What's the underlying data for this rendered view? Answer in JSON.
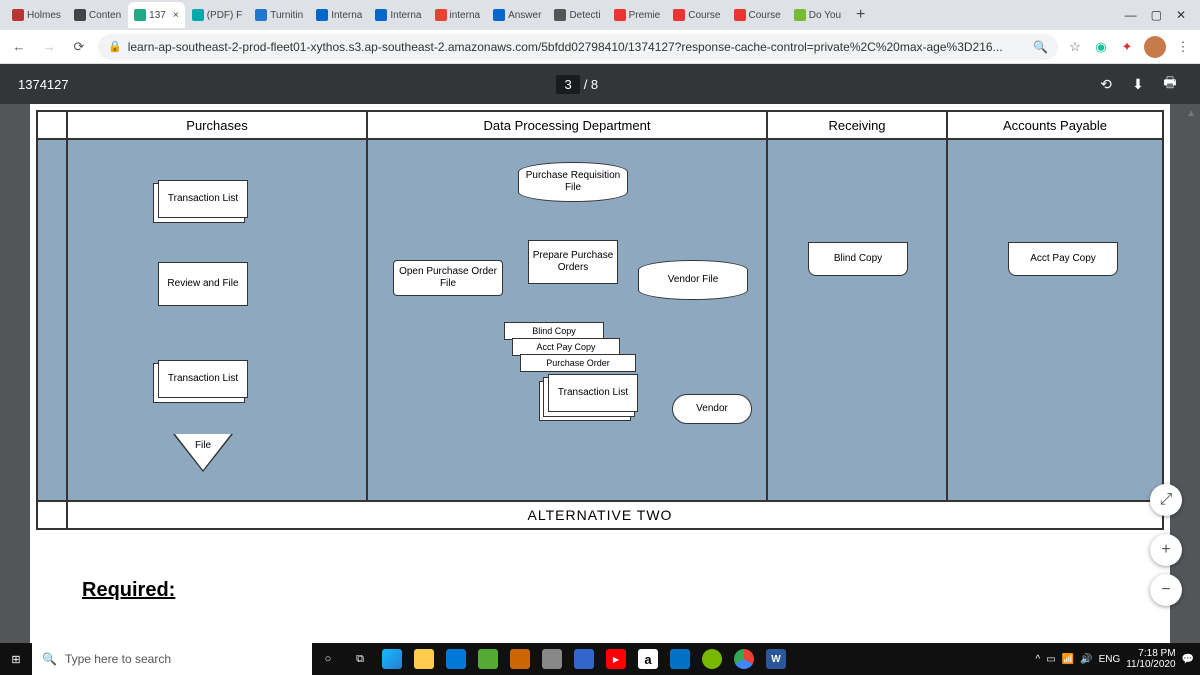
{
  "tabs": [
    {
      "label": "Holmes",
      "fav": "#b33"
    },
    {
      "label": "Conten",
      "fav": "#444"
    },
    {
      "label": "137",
      "fav": "#2a8",
      "active": true,
      "closable": true
    },
    {
      "label": "(PDF) F",
      "fav": "#0aa"
    },
    {
      "label": "Turnitin",
      "fav": "#27c"
    },
    {
      "label": "Interna",
      "fav": "#06c"
    },
    {
      "label": "Interna",
      "fav": "#06c"
    },
    {
      "label": "interna",
      "fav": "#ea4335"
    },
    {
      "label": "Answer",
      "fav": "#06c"
    },
    {
      "label": "Detecti",
      "fav": "#555"
    },
    {
      "label": "Premie",
      "fav": "#e33"
    },
    {
      "label": "Course",
      "fav": "#e33"
    },
    {
      "label": "Course",
      "fav": "#e33"
    },
    {
      "label": "Do You",
      "fav": "#7b3"
    }
  ],
  "url": "learn-ap-southeast-2-prod-fleet01-xythos.s3.ap-southeast-2.amazonaws.com/5bfdd02798410/1374127?response-cache-control=private%2C%20max-age%3D216...",
  "pdf": {
    "filename": "1374127",
    "curPage": "3",
    "totalPages": "/ 8"
  },
  "diagram": {
    "cols": {
      "c1": "Purchases",
      "c2": "Data Processing Department",
      "c3": "Receiving",
      "c4": "Accounts Payable"
    },
    "nodes": {
      "transList1": "Transaction\nList",
      "review": "Review\nand\nFile",
      "transList2": "Transaction\nList",
      "file": "File",
      "openPO": "Open Purchase\nOrder File",
      "prFile": "Purchase\nRequisition File",
      "prepare": "Prepare\nPurchase\nOrders",
      "vendorFile": "Vendor File",
      "blindCap": "Blind Copy",
      "apCap": "Acct Pay Copy",
      "poCap": "Purchase Order",
      "transList3": "Transaction\nList",
      "vendor": "Vendor",
      "blindCopy": "Blind Copy",
      "apCopy": "Acct Pay Copy"
    },
    "footer": "ALTERNATIVE TWO"
  },
  "required": "Required:",
  "search_placeholder": "Type here to search",
  "tray": {
    "lang": "ENG",
    "time": "7:18 PM",
    "date": "11/10/2020"
  }
}
